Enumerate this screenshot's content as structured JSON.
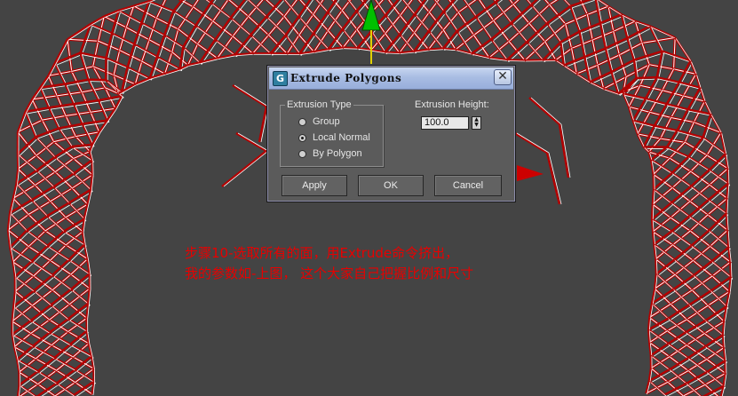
{
  "dialog": {
    "title": "Extrude Polygons",
    "icon": "3ds-max-app-icon",
    "close_label": "✕",
    "extrusion_type": {
      "label": "Extrusion Type",
      "options": [
        "Group",
        "Local Normal",
        "By Polygon"
      ],
      "selected": "Local Normal"
    },
    "extrusion_height": {
      "label": "Extrusion Height:",
      "value": "100.0"
    },
    "buttons": {
      "apply": "Apply",
      "ok": "OK",
      "cancel": "Cancel"
    }
  },
  "annotation": {
    "line1": "步骤10-选取所有的面，用Extrude命令挤出，",
    "line2": "我的参数如-上图，  这个大家自己把握比例和尺寸"
  },
  "colors": {
    "viewport_bg": "#444444",
    "wire_red": "#b40000",
    "wire_white": "#ffffff",
    "gizmo_green": "#00c000",
    "caption_red": "#e80000"
  }
}
